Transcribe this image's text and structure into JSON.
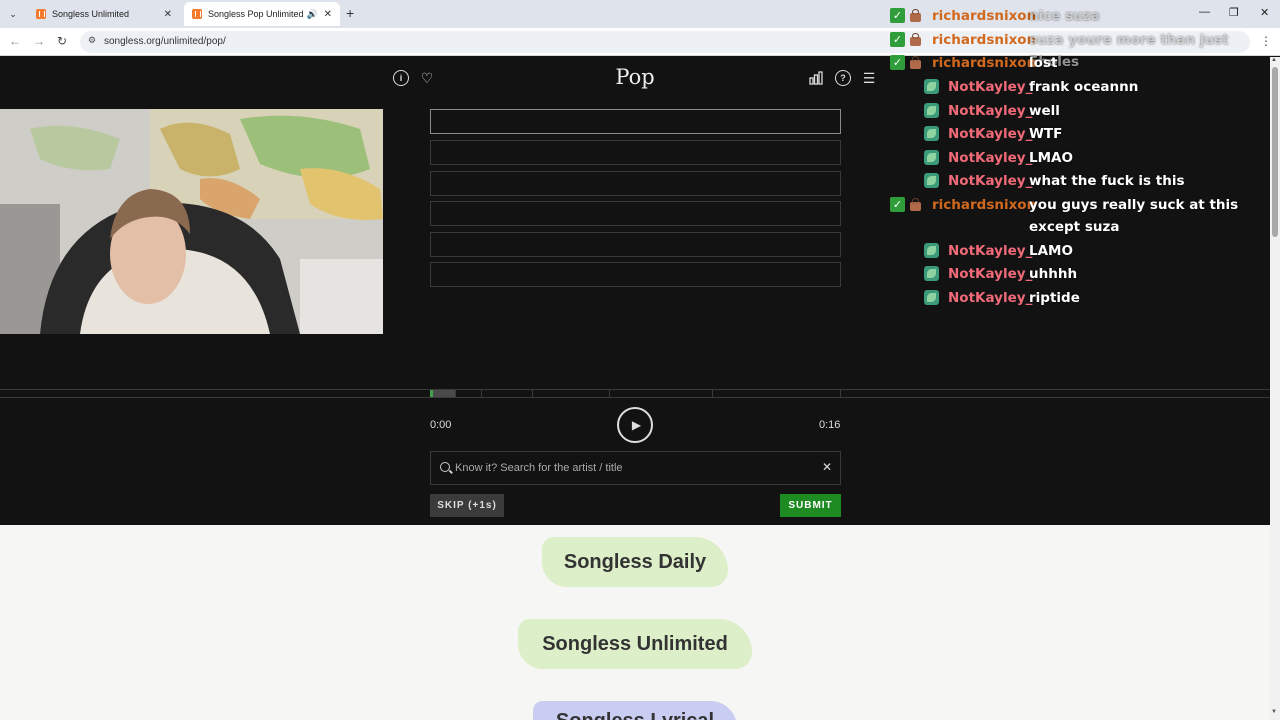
{
  "browser": {
    "tabs": [
      {
        "title": "Songless Unlimited",
        "active": false
      },
      {
        "title": "Songless Pop Unlimited",
        "active": true
      }
    ],
    "url": "songless.org/unlimited/pop/"
  },
  "game": {
    "title": "Pop",
    "time_start": "0:00",
    "time_end": "0:16",
    "search_placeholder": "Know it? Search for the artist / title",
    "skip_label": "SKIP (+1s)",
    "submit_label": "SUBMIT",
    "accent_color": "#1e8a22",
    "guess_rows": 6,
    "progress_fraction": 0.06
  },
  "lower": {
    "modes": [
      "Songless Daily",
      "Songless Unlimited",
      "Songless Lyrical"
    ]
  },
  "chat": {
    "messages": [
      {
        "user": "richardsnixon",
        "text": "nice suza"
      },
      {
        "user": "richardsnixon",
        "text": "suza youre more than just 5holes"
      },
      {
        "user": "richardsnixon",
        "text": "lost"
      },
      {
        "user": "NotKayley_",
        "text": "frank oceannn"
      },
      {
        "user": "NotKayley_",
        "text": "well"
      },
      {
        "user": "NotKayley_",
        "text": "WTF"
      },
      {
        "user": "NotKayley_",
        "text": "LMAO"
      },
      {
        "user": "NotKayley_",
        "text": "what the fuck is this"
      },
      {
        "user": "richardsnixon",
        "text": "you guys really suck at this except suza"
      },
      {
        "user": "NotKayley_",
        "text": "LAMO"
      },
      {
        "user": "NotKayley_",
        "text": "uhhhh"
      },
      {
        "user": "NotKayley_",
        "text": "riptide"
      }
    ]
  }
}
